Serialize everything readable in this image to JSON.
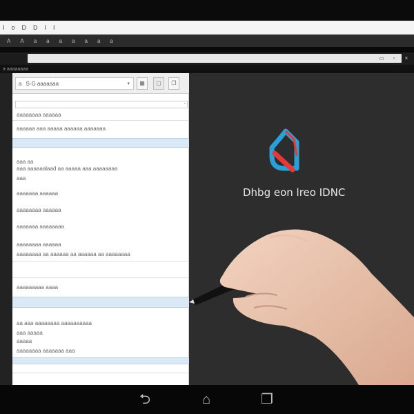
{
  "menubar": {
    "items": [
      "I",
      "o",
      "D",
      "D",
      "I",
      "I"
    ]
  },
  "toolbar": {
    "items": [
      "A",
      "A",
      "a",
      "a",
      "a",
      "a",
      "a",
      "a",
      "a"
    ]
  },
  "tabstrip": {
    "label": "a aaaaaaaa"
  },
  "panel": {
    "dropdown_icon": "a",
    "dropdown_text": "S-G  aaaaaaa",
    "rows": [
      "aaaaaaaa aaaaaa",
      "aaaaaa aaa aaaaa aaaaaa aaaaaaa",
      "aaa aa",
      "aaa aaaaaalaad aa aaaaa aaa aaaaaaaa",
      "aaa",
      "aaaaaaa aaaaaa",
      "aaaaaaaa aaaaaa",
      "aaaaaaa aaaaaaaa",
      "aaaaaaaa aaaaaa",
      "aaaaaaaa aa aaaaaa aa aaaaaa aa aaaaaaaa",
      "aaaaaaaaa aaaa",
      "aa aaa aaaaaaaa aaaaaaaaaa",
      "aaa aaaaa",
      "aaaaa",
      "aaaaaaaa aaaaaaa aaa"
    ]
  },
  "canvas": {
    "logo_text": "Dhbg eon lreo IDNC"
  },
  "colors": {
    "accent_blue": "#2aa0d8",
    "accent_red": "#e23a3a",
    "panel_band": "#dbe9f6"
  },
  "navbar": {
    "back_icon": "back-icon",
    "home_icon": "home-icon",
    "recent_icon": "recent-apps-icon"
  }
}
